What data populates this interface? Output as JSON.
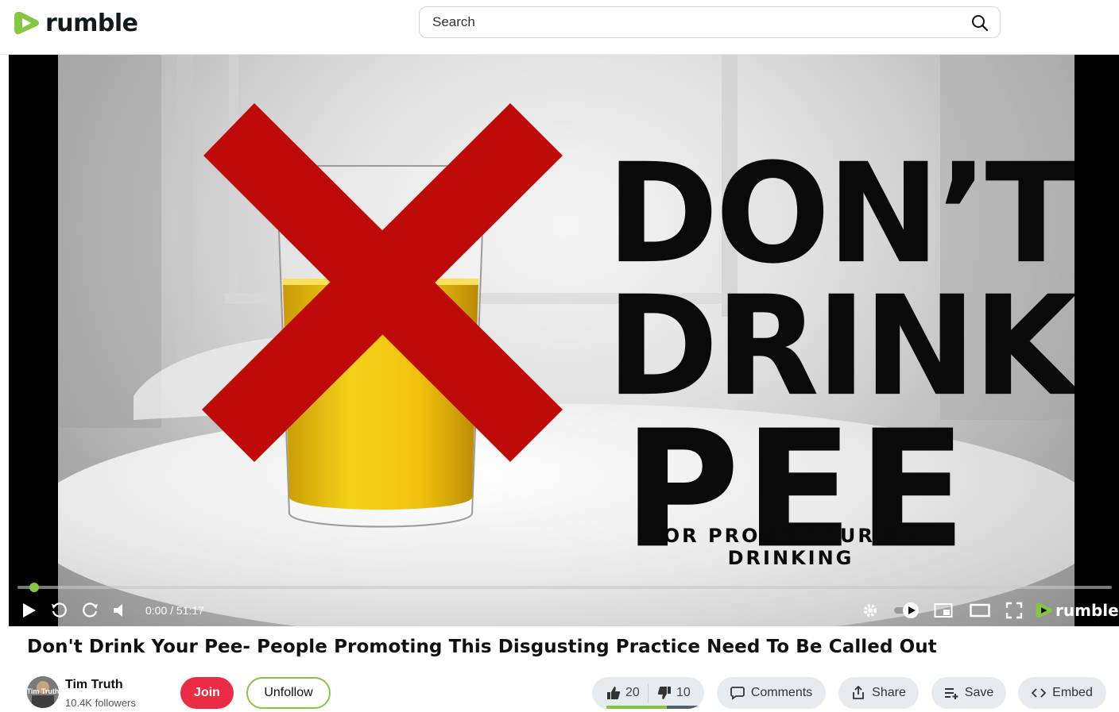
{
  "header": {
    "logo_text": "rumble",
    "search_placeholder": "Search"
  },
  "player": {
    "thumbnail": {
      "line1": "DON’T",
      "line2": "DRINK",
      "line3": "PEE",
      "subline": "OR PROMOTE URINE DRINKING"
    },
    "time_display": "0:00 / 51:17",
    "progress_fraction": 0.0,
    "logo_text": "rumble",
    "icons": [
      "play-icon",
      "rewind-icon",
      "forward-icon",
      "volume-icon",
      "settings-icon",
      "autoplay-toggle-icon",
      "pip-icon",
      "theater-icon",
      "fullscreen-icon"
    ]
  },
  "video": {
    "title": "Don't Drink Your Pee- People Promoting This Disgusting Practice Need To Be Called Out"
  },
  "channel": {
    "name": "Tim Truth",
    "followers": "10.4K followers",
    "avatar_text": "Tim Truth"
  },
  "actions": {
    "join_label": "Join",
    "unfollow_label": "Unfollow",
    "upvotes": "20",
    "downvotes": "10",
    "comments_label": "Comments",
    "share_label": "Share",
    "save_label": "Save",
    "embed_label": "Embed"
  },
  "colors": {
    "brand_green": "#85c742",
    "join_red": "#ea2c45",
    "pill_bg": "#e6ebf0"
  }
}
